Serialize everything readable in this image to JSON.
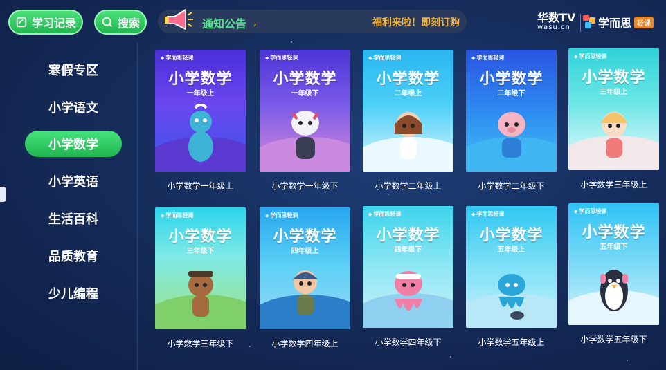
{
  "topbar": {
    "history_label": "学习记录",
    "search_label": "搜索",
    "notice_label": "通知公告",
    "notice_sep": ",",
    "notice_promo": "福利来啦！即刻订购",
    "brand_wasu": "华数TV",
    "brand_wasu_sub": "wasu.cn",
    "brand_xes": "学而思",
    "brand_xes_tag": "轻课"
  },
  "sidebar": {
    "items": [
      {
        "label": "寒假专区",
        "active": false
      },
      {
        "label": "小学语文",
        "active": false
      },
      {
        "label": "小学数学",
        "active": true
      },
      {
        "label": "小学英语",
        "active": false
      },
      {
        "label": "生活百科",
        "active": false
      },
      {
        "label": "品质教育",
        "active": false
      },
      {
        "label": "少儿编程",
        "active": false
      }
    ]
  },
  "cards": [
    {
      "logo": "学而思轻课",
      "title": "小学数学",
      "grade": "一年级上",
      "caption": "小学数学一年级上",
      "theme": "th-purple",
      "accent": "#3fb3d6"
    },
    {
      "logo": "学而思轻课",
      "title": "小学数学",
      "grade": "一年级下",
      "caption": "小学数学一年级下",
      "theme": "th-pink",
      "accent": "#e8e8f0"
    },
    {
      "logo": "学而思轻课",
      "title": "小学数学",
      "grade": "二年级上",
      "caption": "小学数学二年级上",
      "theme": "th-cyan",
      "accent": "#8b4a2a"
    },
    {
      "logo": "学而思轻课",
      "title": "小学数学",
      "grade": "二年级下",
      "caption": "小学数学二年级下",
      "theme": "th-blue",
      "accent": "#f4b4c4"
    },
    {
      "logo": "学而思轻课",
      "title": "小学数学",
      "grade": "三年级上",
      "caption": "小学数学三年级上",
      "theme": "th-teal",
      "accent": "#f4c36a"
    },
    {
      "logo": "学而思轻课",
      "title": "小学数学",
      "grade": "三年级下",
      "caption": "小学数学三年级下",
      "theme": "th-green",
      "accent": "#a56a3d"
    },
    {
      "logo": "学而思轻课",
      "title": "小学数学",
      "grade": "四年级上",
      "caption": "小学数学四年级上",
      "theme": "th-sea",
      "accent": "#3b5a8a"
    },
    {
      "logo": "学而思轻课",
      "title": "小学数学",
      "grade": "四年级下",
      "caption": "小学数学四年级下",
      "theme": "th-aqua",
      "accent": "#f07fa8"
    },
    {
      "logo": "学而思轻课",
      "title": "小学数学",
      "grade": "五年级上",
      "caption": "小学数学五年级上",
      "theme": "th-sky",
      "accent": "#2aa6d8"
    },
    {
      "logo": "学而思轻课",
      "title": "小学数学",
      "grade": "五年级下",
      "caption": "小学数学五年级下",
      "theme": "th-ice",
      "accent": "#2a2f3f"
    }
  ]
}
